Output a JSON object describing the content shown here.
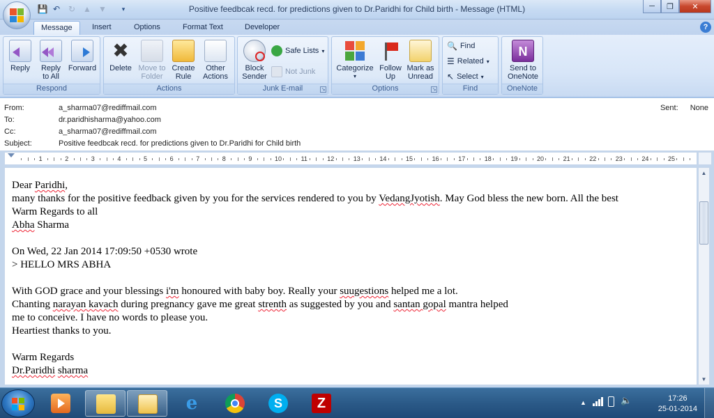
{
  "window": {
    "title": "Positive feedbcak recd. for predictions given to Dr.Paridhi for Child birth - Message (HTML)",
    "controls": [
      "minimize",
      "maximize",
      "close"
    ]
  },
  "tabs": [
    "Message",
    "Insert",
    "Options",
    "Format Text",
    "Developer"
  ],
  "active_tab": "Message",
  "ribbon": {
    "respond": {
      "label": "Respond",
      "reply": "Reply",
      "reply_all_1": "Reply",
      "reply_all_2": "to All",
      "forward": "Forward"
    },
    "actions": {
      "label": "Actions",
      "delete": "Delete",
      "move_1": "Move to",
      "move_2": "Folder",
      "create_1": "Create",
      "create_2": "Rule",
      "other_1": "Other",
      "other_2": "Actions"
    },
    "junk": {
      "label": "Junk E-mail",
      "block_1": "Block",
      "block_2": "Sender",
      "safe_lists": "Safe Lists",
      "not_junk": "Not Junk"
    },
    "options": {
      "label": "Options",
      "categorize": "Categorize",
      "follow_1": "Follow",
      "follow_2": "Up",
      "mark_1": "Mark as",
      "mark_2": "Unread"
    },
    "find": {
      "label": "Find",
      "find": "Find",
      "related": "Related",
      "select": "Select"
    },
    "onenote": {
      "label": "OneNote",
      "send_1": "Send to",
      "send_2": "OneNote"
    }
  },
  "header": {
    "from_label": "From:",
    "from": "a_sharma07@rediffmail.com",
    "to_label": "To:",
    "to": "dr.paridhisharma@yahoo.com",
    "cc_label": "Cc:",
    "cc": "a_sharma07@rediffmail.com",
    "subject_label": "Subject:",
    "subject": "Positive feedbcak recd. for predictions given to Dr.Paridhi for Child birth",
    "sent_label": "Sent:",
    "sent": "None"
  },
  "ruler_numbers": [
    "1",
    "2",
    "3",
    "4",
    "5",
    "6",
    "7",
    "8",
    "9",
    "10",
    "11",
    "12",
    "13",
    "14",
    "15",
    "16",
    "17",
    "18",
    "19",
    "20",
    "21",
    "22",
    "23",
    "24",
    "25"
  ],
  "body": {
    "l1a": "Dear ",
    "l1b": "Paridhi",
    "l2a": "many thanks for the positive feedback given by you for the services rendered to you by ",
    "l2b": "VedangJyotish",
    "l2c": ". May God bless the new born. All the best",
    "l3": "Warm Regards to all",
    "l4a": "Abha",
    "l4b": " Sharma",
    "l5": "On Wed, 22 Jan 2014 17:09:50 +0530  wrote",
    "l6": "> HELLO MRS ABHA",
    "l7a": "With GOD grace and your blessings ",
    "l7b": "i'm",
    "l7c": " honoured with baby boy. Really your ",
    "l7d": "suugestions",
    "l7e": " helped me a lot.",
    "l8a": "Chanting ",
    "l8b": "narayan kavach",
    "l8c": " during pregnancy gave me great ",
    "l8d": "strenth",
    "l8e": " as suggested by you and ",
    "l8f": "santan gopal",
    "l8g": " mantra helped",
    "l9": "me to conceive. I have no words to please you.",
    "l10": "Heartiest thanks to you.",
    "l11": "Warm Regards",
    "l12a": "Dr.Paridhi",
    "l12b": " ",
    "l12c": "sharma"
  },
  "taskbar": {
    "apps": [
      "media-player",
      "file-explorer",
      "outlook",
      "internet-explorer",
      "chrome",
      "skype",
      "filezilla"
    ],
    "time": "17:26",
    "date": "25-01-2014"
  }
}
